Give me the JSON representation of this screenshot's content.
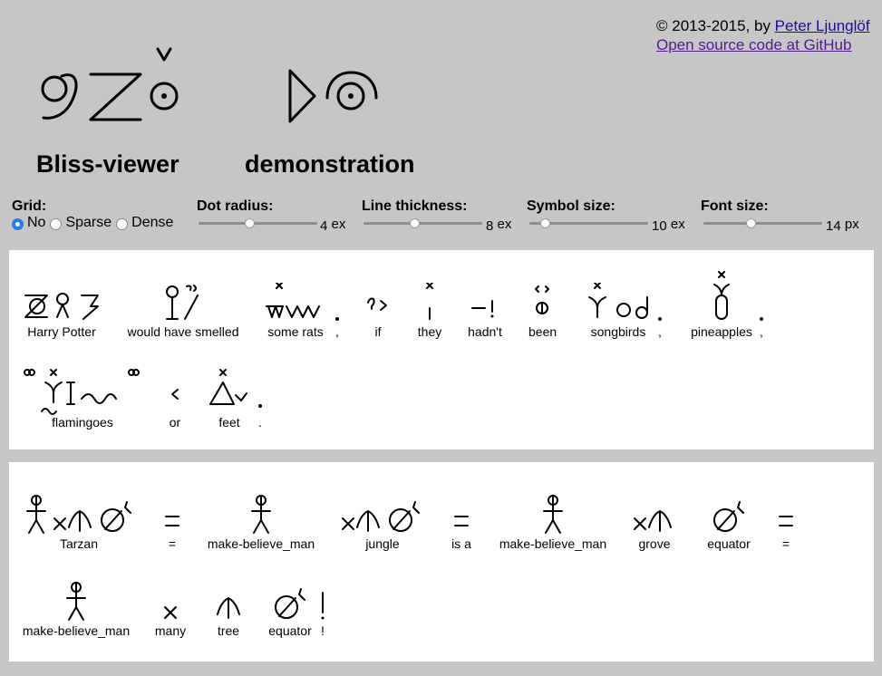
{
  "credits": {
    "prefix": "© 2013-2015, by ",
    "author_link": "Peter Ljunglöf",
    "github_link": "Open source code at GitHub"
  },
  "header": {
    "title_left": "Bliss-viewer",
    "title_right": "demonstration"
  },
  "controls": {
    "grid": {
      "label": "Grid:",
      "options": [
        "No",
        "Sparse",
        "Dense"
      ],
      "selected": "No"
    },
    "dot_radius": {
      "label": "Dot radius:",
      "value": "4",
      "unit": "ex",
      "fraction": 0.43
    },
    "line_thickness": {
      "label": "Line thickness:",
      "value": "8",
      "unit": "ex",
      "fraction": 0.43
    },
    "symbol_size": {
      "label": "Symbol size:",
      "value": "10",
      "unit": "ex",
      "fraction": 0.13
    },
    "font_size": {
      "label": "Font size:",
      "value": "14",
      "unit": "px",
      "fraction": 0.4
    }
  },
  "sentence1": [
    {
      "gloss": "Harry Potter"
    },
    {
      "gloss": "would have smelled"
    },
    {
      "gloss": "some rats"
    },
    {
      "gloss": ","
    },
    {
      "gloss": "if"
    },
    {
      "gloss": "they"
    },
    {
      "gloss": "hadn't"
    },
    {
      "gloss": "been"
    },
    {
      "gloss": "songbirds"
    },
    {
      "gloss": ","
    },
    {
      "gloss": "pineapples"
    },
    {
      "gloss": ","
    },
    {
      "gloss": "flamingoes"
    },
    {
      "gloss": "or"
    },
    {
      "gloss": "feet"
    },
    {
      "gloss": "."
    }
  ],
  "sentence2": [
    {
      "gloss": "Tarzan"
    },
    {
      "gloss": "="
    },
    {
      "gloss": "make-believe_man"
    },
    {
      "gloss": "jungle"
    },
    {
      "gloss": "is a"
    },
    {
      "gloss": "make-believe_man"
    },
    {
      "gloss": "grove"
    },
    {
      "gloss": "equator"
    },
    {
      "gloss": "="
    },
    {
      "gloss": "make-believe_man"
    },
    {
      "gloss": "many"
    },
    {
      "gloss": "tree"
    },
    {
      "gloss": "equator"
    },
    {
      "gloss": "!"
    }
  ]
}
